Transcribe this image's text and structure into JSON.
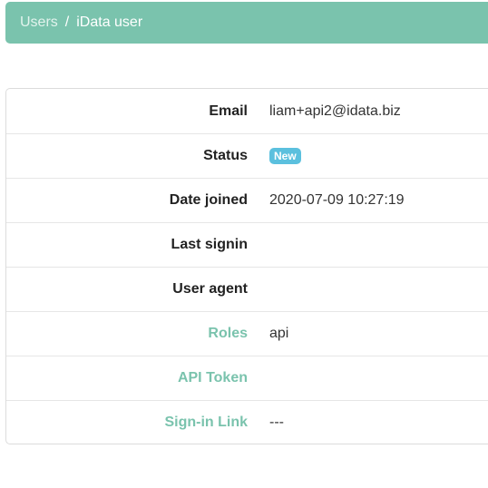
{
  "breadcrumb": {
    "parent": "Users",
    "separator": "/",
    "current": "iData user"
  },
  "details": {
    "email": {
      "label": "Email",
      "value": "liam+api2@idata.biz"
    },
    "status": {
      "label": "Status",
      "badge": "New"
    },
    "date_joined": {
      "label": "Date joined",
      "value": "2020-07-09 10:27:19"
    },
    "last_signin": {
      "label": "Last signin",
      "value": ""
    },
    "user_agent": {
      "label": "User agent",
      "value": ""
    },
    "roles": {
      "label": "Roles",
      "value": "api"
    },
    "api_token": {
      "label": "API Token",
      "value": ""
    },
    "signin_link": {
      "label": "Sign-in Link",
      "value": "---"
    }
  },
  "colors": {
    "accent": "#7ac3ad",
    "badge": "#5bc0de"
  }
}
